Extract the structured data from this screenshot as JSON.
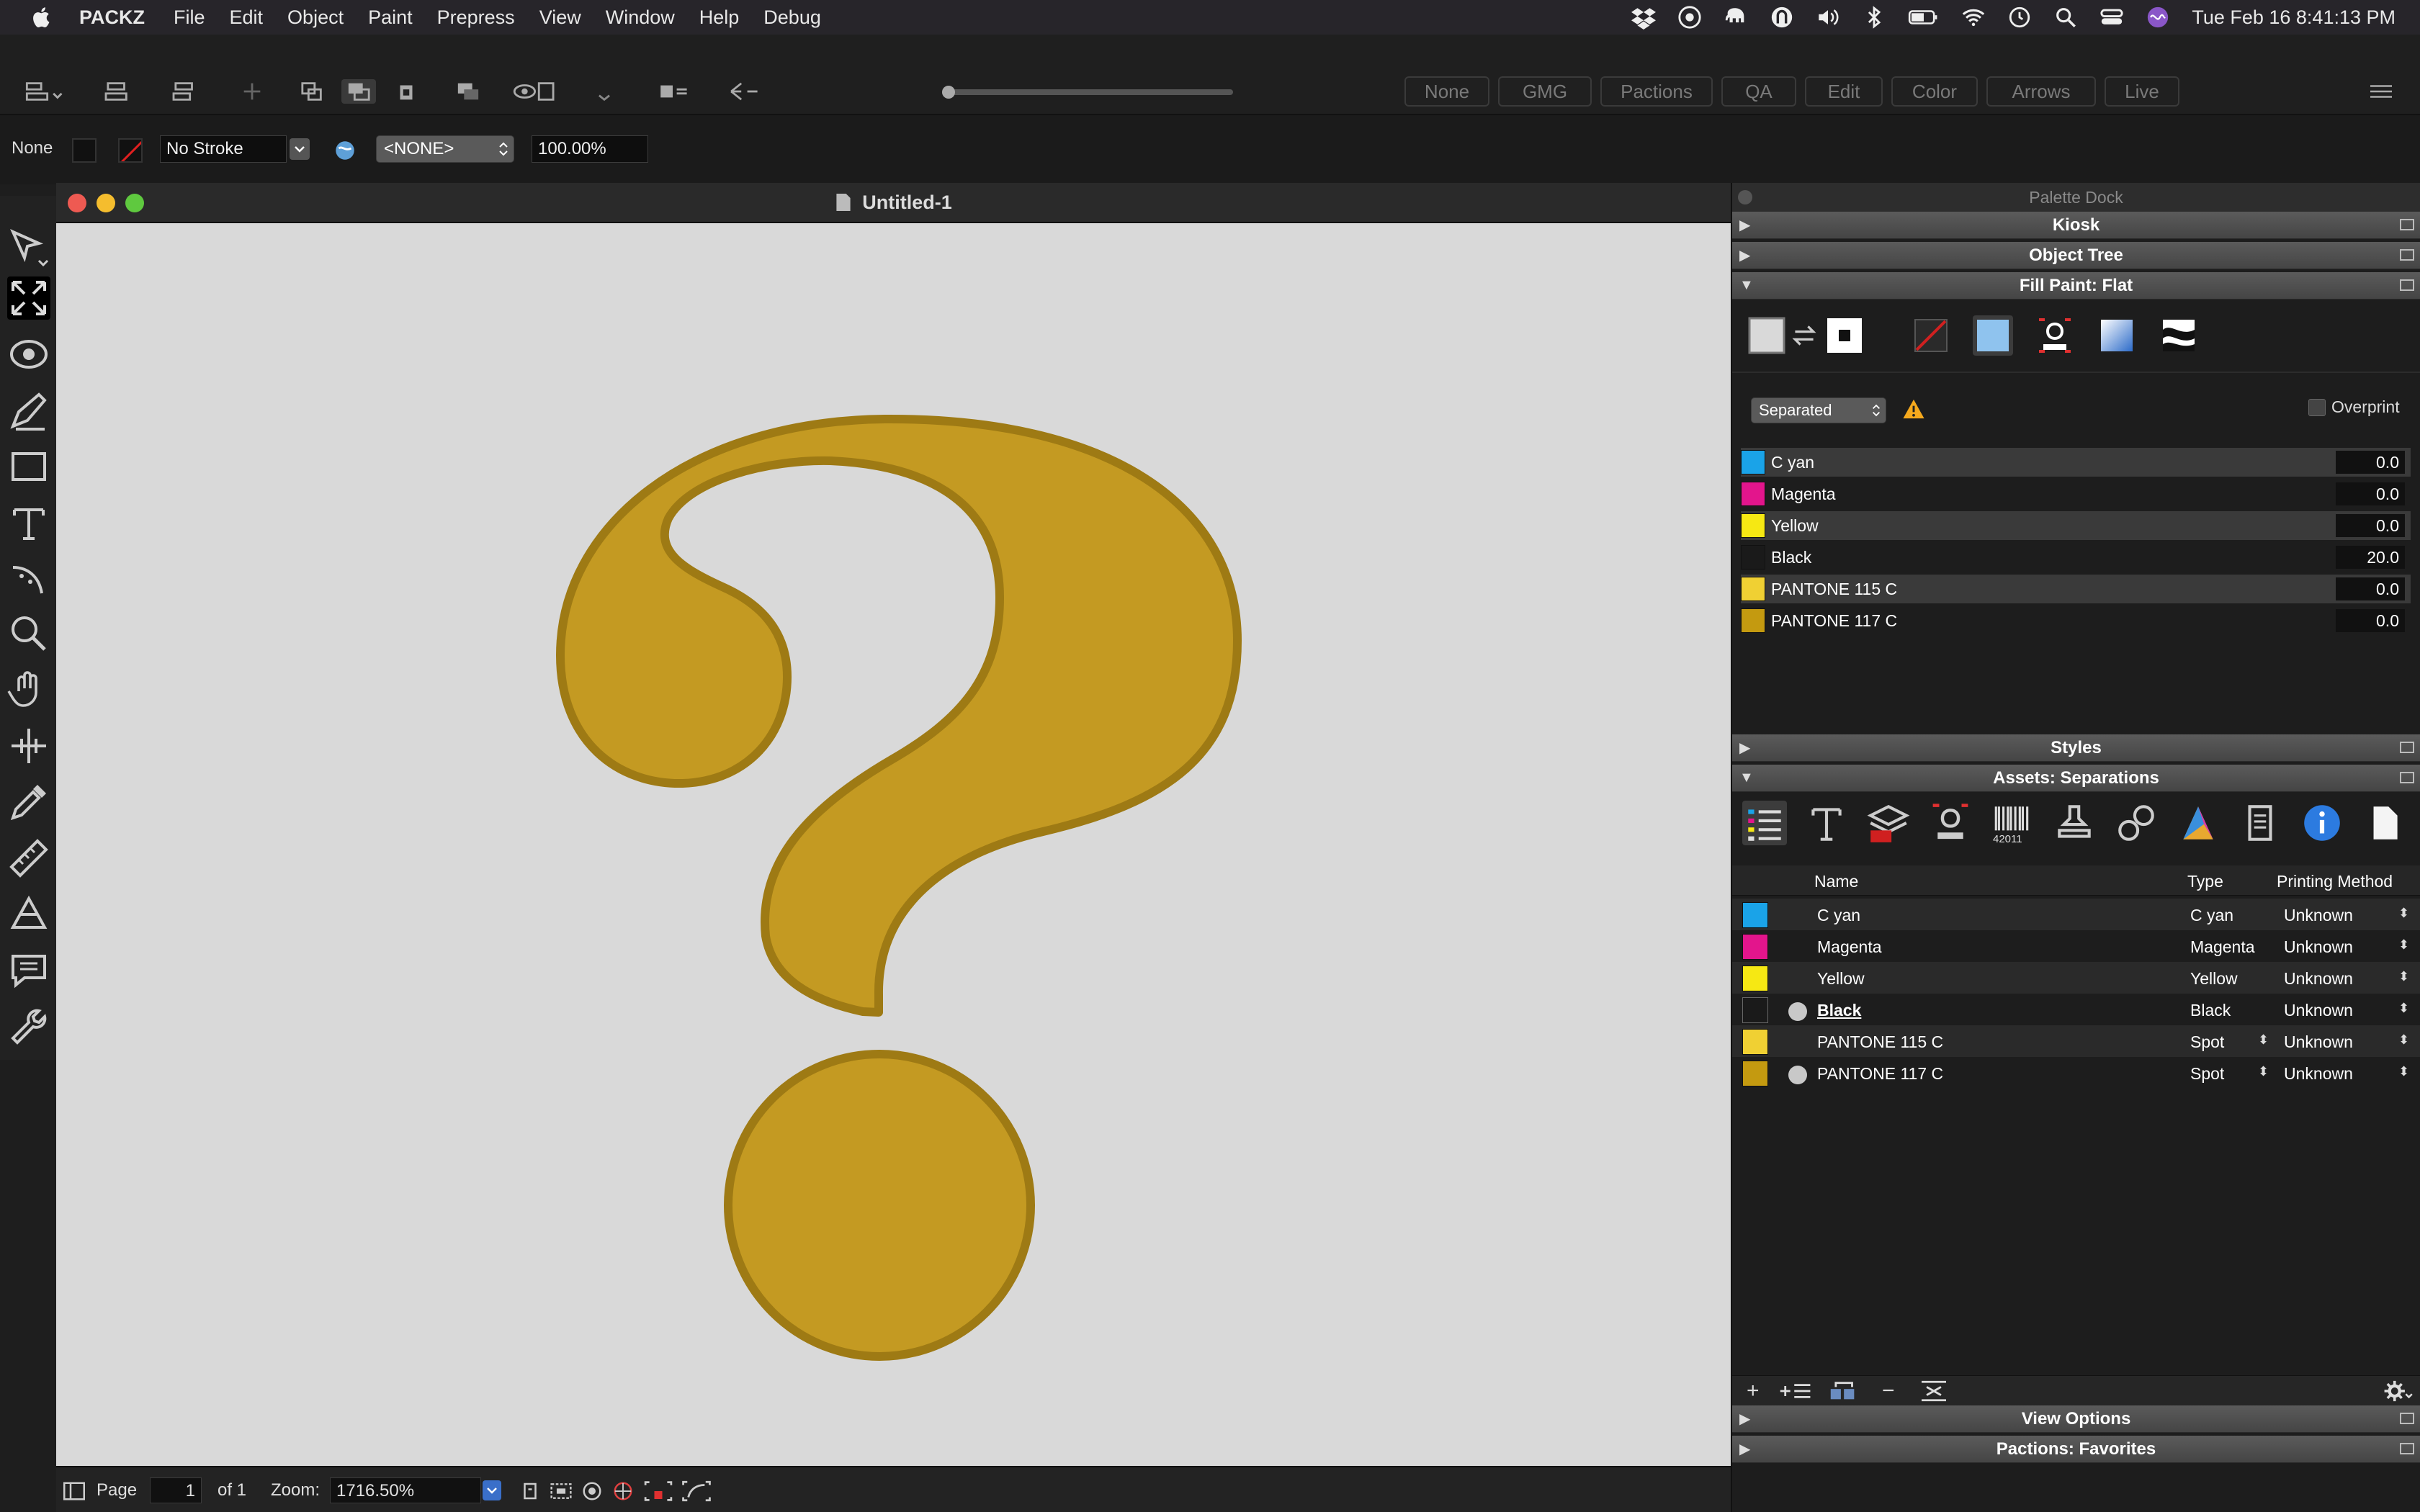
{
  "menubar": {
    "app": "PACKZ",
    "items": [
      "File",
      "Edit",
      "Object",
      "Paint",
      "Prepress",
      "View",
      "Window",
      "Help",
      "Debug"
    ],
    "clock": "Tue Feb 16  8:41:13 PM"
  },
  "toolbar": {
    "workspaces": [
      "None",
      "GMG",
      "Pactions",
      "QA",
      "Edit",
      "Color",
      "Arrows",
      "Live"
    ]
  },
  "propbar": {
    "fill_label": "None",
    "stroke_value": "No Stroke",
    "style_value": "<NONE>",
    "opacity_value": "100.00%"
  },
  "document": {
    "title": "Untitled-1",
    "artwork_color": "#c49a22",
    "page_label": "Page",
    "page_value": "1",
    "page_of": "of 1",
    "zoom_label": "Zoom:",
    "zoom_value": "1716.50%"
  },
  "dock": {
    "title": "Palette Dock",
    "panels": {
      "kiosk": "Kiosk",
      "object_tree": "Object Tree",
      "fill_paint": "Fill Paint: Flat",
      "styles": "Styles",
      "assets": "Assets: Separations",
      "view_options": "View Options",
      "pactions": "Pactions: Favorites"
    },
    "fill": {
      "mode": "Separated",
      "overprint_label": "Overprint",
      "separations": [
        {
          "name": "C yan",
          "value": "0.0",
          "color": "#1aa3e8"
        },
        {
          "name": "Magenta",
          "value": "0.0",
          "color": "#e3158c"
        },
        {
          "name": "Yellow",
          "value": "0.0",
          "color": "#f6e813"
        },
        {
          "name": "Black",
          "value": "20.0",
          "color": "#1a1a1a"
        },
        {
          "name": "PANTONE 115 C",
          "value": "0.0",
          "color": "#f0d033"
        },
        {
          "name": "PANTONE 117 C",
          "value": "0.0",
          "color": "#c49a10"
        }
      ]
    },
    "assets_table": {
      "headers": {
        "name": "Name",
        "type": "Type",
        "method": "Printing Method"
      },
      "rows": [
        {
          "name": "C yan",
          "type": "C yan",
          "method": "Unknown",
          "color": "#1aa3e8"
        },
        {
          "name": "Magenta",
          "type": "Magenta",
          "method": "Unknown",
          "color": "#e3158c"
        },
        {
          "name": "Yellow",
          "type": "Yellow",
          "method": "Unknown",
          "color": "#f6e813"
        },
        {
          "name": "Black",
          "type": "Black",
          "method": "Unknown",
          "color": "#1a1a1a"
        },
        {
          "name": "PANTONE 115 C",
          "type": "Spot",
          "method": "Unknown",
          "color": "#f0d033"
        },
        {
          "name": "PANTONE 117 C",
          "type": "Spot",
          "method": "Unknown",
          "color": "#c49a10"
        }
      ]
    },
    "barcode_label": "42011"
  }
}
